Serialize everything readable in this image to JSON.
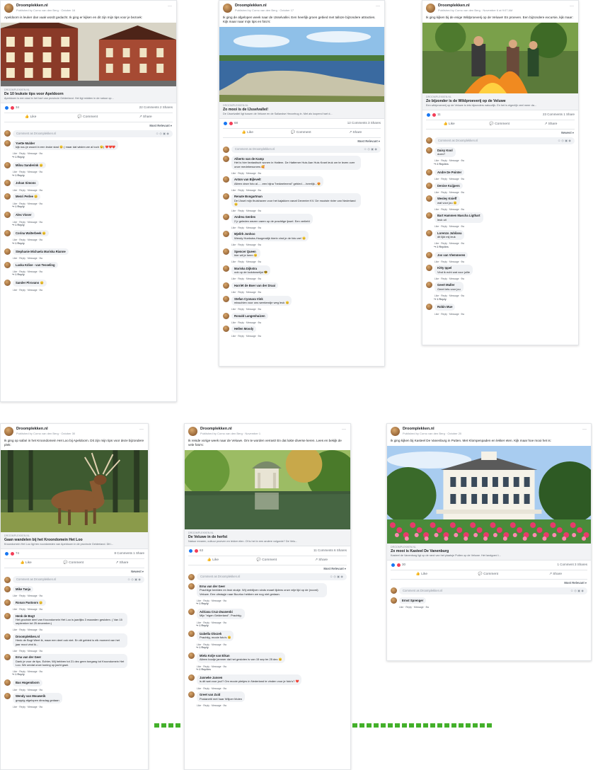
{
  "page_name": "Droomplekken.nl",
  "actions": {
    "like": "Like",
    "comment": "Comment",
    "share": "Share"
  },
  "comment_placeholder": "Comment as Droomplekken.nl",
  "comment_meta": "Like · Reply · Message · 8w",
  "posts": [
    {
      "meta": "Published by Corno van den Berg · October 16",
      "caption": "Apeldoorn is leuker dan vaak wordt gedacht. Ik ging er kijken en dit zijn mijn tips voor je bezoek:",
      "domain": "DROOMPLEKKEN.NL",
      "title": "De 10 leukste tips voor Apeldoorn",
      "desc": "Apeldoorn is een stad in het hart van provincie Gelderland. Het ligt midden in de natuur op...",
      "reactions": "34",
      "counts": "22 Comments 2 Shares",
      "sort": "Most Relevant ▾",
      "comments": [
        {
          "name": "Yvette Mulder",
          "text": "kijk nou je woont in een leuke stad 😊 ( maar dat wisten we al toch 😉) ❤️❤️❤️",
          "reply": "↪ 1 Reply"
        },
        {
          "name": "Milou Sanderink 😊",
          "text": "",
          "reply": "↪ 1 Reply"
        },
        {
          "name": "Johan Simons",
          "text": "",
          "reply": ""
        },
        {
          "name": "Menri Perlee 😊",
          "text": "",
          "reply": "↪ 1 Reply"
        },
        {
          "name": "Alex Visser",
          "text": "",
          "reply": "↪ 1 Reply"
        },
        {
          "name": "Corina Walterbeek 😊",
          "text": "",
          "reply": "↪ 1 Reply"
        },
        {
          "name": "Stephanie Michaela Mariska Rianne",
          "text": "",
          "reply": ""
        },
        {
          "name": "Laska Kdise - van Tesseling",
          "text": "",
          "reply": "↪ 1 Reply"
        },
        {
          "name": "Sander Pirovano 😊",
          "text": "",
          "reply": ""
        }
      ]
    },
    {
      "meta": "Published by Corno van den Berg · October 17",
      "caption": "Ik ging de afgelopen week naar de IJsselvallei. Een heerlijk groen gebied met talloze bijzondere attracties. Kijk maar naar mijn tips en foto's:",
      "domain": "DROOMPLEKKEN.NL",
      "title": "Zo mooi is de IJsselvallei!",
      "desc": "De IJsselvallei ligt tussen de Veluwe en de Sallandse Heuvelrug in. Met als loopend hart d...",
      "reactions": "68",
      "counts": "12 Comments 3 Shares",
      "sort": "Most Relevant ▾",
      "comments": [
        {
          "name": "Alberto van de Kamp",
          "text": "Het is hier fantastisch wonen in Hattem. De Hattemer Huis Aan Huis Krant leuk om te lezen over onze medebewoners 🥰",
          "reply": ""
        },
        {
          "name": "Anton van Bijlevelt",
          "text": "Alleen deze foto al......een bijna \"bedwelmend\" gebied.....heerlijk...😍",
          "reply": ""
        },
        {
          "name": "Renate Bongartman",
          "text": "De IJssel mijn thuishaven voor het kajakken vanaf Deventer KV. De mooiste rivier van Nederland 😊",
          "reply": ""
        },
        {
          "name": "Andrea Gerdes",
          "text": "2 jr geleden wezen varen op de prachtige ijssel. Een verliefd",
          "reply": ""
        },
        {
          "name": "Mjelith Jonhoo",
          "text": "Wendy Hoekstra-Hoogendijk hierin vind je de foto we! 😊",
          "reply": ""
        },
        {
          "name": "Spencer Queen",
          "text": "hier wil je heen 😊",
          "reply": ""
        },
        {
          "name": "Mariska Dijkstra",
          "text": "ook op de lockdownlijst 😎",
          "reply": ""
        },
        {
          "name": "Harriët de Boer van der Draai",
          "text": "",
          "reply": ""
        },
        {
          "name": "Stefan Cyonara Vink",
          "text": "misschien voor ons weekendje weg leuk 😊",
          "reply": ""
        },
        {
          "name": "Ronald Langenhuizen",
          "text": "",
          "reply": ""
        },
        {
          "name": "Hellen Moody",
          "text": "",
          "reply": ""
        }
      ]
    },
    {
      "meta": "Published by Corno van den Berg · November 6 at 9:07 AM",
      "caption": "Ik ging kijken bij de enige Wildproeverij op de Veluwe! En proeven. Een bijzondere excursie, kijk maar:",
      "domain": "DROOMPLEKKEN.NL",
      "title": "Zo bijzonder is de Wildproeverij op de Veluwe",
      "desc": "Een wildproeverij op de Veluwe is iets bijzonders natuurlijk. En het is eigenlijk veel meer da...",
      "reactions": "11",
      "counts": "23 Comments 1 Share",
      "sort": "Newest ▾",
      "comments": [
        {
          "name": "Daisy Kool",
          "text": "doen?",
          "reply": "↪ 2 Replies"
        },
        {
          "name": "Andre De Pointer",
          "text": "",
          "reply": ""
        },
        {
          "name": "Denise Kuijpers",
          "text": "",
          "reply": ""
        },
        {
          "name": "Wesley Knieff",
          "text": "wat voor jou 😊",
          "reply": ""
        },
        {
          "name": "Bart Hammen Mascha Ligthart",
          "text": "leuk uit",
          "reply": ""
        },
        {
          "name": "Lorenzo Jubilana",
          "text": "dit lijkt mij leuk",
          "reply": "↪ 2 Replies"
        },
        {
          "name": "Jos van Vlemmeren",
          "text": "",
          "reply": ""
        },
        {
          "name": "Kitty Ippel",
          "text": "Vind ik echt wat voor jullie",
          "reply": ""
        },
        {
          "name": "Geert Muller",
          "text": "Geert iets voor jou",
          "reply": "↪ 1 Reply"
        },
        {
          "name": "Robin Mue",
          "text": "",
          "reply": ""
        }
      ]
    },
    {
      "meta": "Published by Corno van den Berg · October 30",
      "caption": "Ik ging op safari in het Kroondomein Het Loo bij Apeldoorn. Dit zijn mijn tips voor deze bijzondere plek:",
      "domain": "DROOMPLEKKEN.NL",
      "title": "Gaan wandelen bij het Kroondomein Het Loo",
      "desc": "Kroondomein Het Loo ligt ten noordwesten van Apeldoorn in de provincie Gelderland. Dit i...",
      "reactions": "74",
      "counts": "8 Comments 1 Share",
      "sort": "Newest ▾",
      "comments": [
        {
          "name": "Mike Tanja",
          "text": "",
          "reply": ""
        },
        {
          "name": "Ronan Pastoors 😊",
          "text": "",
          "reply": ""
        },
        {
          "name": "Henk de Bogt",
          "text": "Het grootste deel van Kroondomein Het Loo is jaarlijks 3 maanden gesloten. ( Van 15 september tot 25 december.)",
          "reply": ""
        },
        {
          "name": "Droomplekken.nl",
          "text": "Henk de Bogt Weet ik, maar een deel ook niet. En dit gebied is elk moment van het jaar mooi vind ik...",
          "reply": ""
        },
        {
          "name": "Erna van der Geer",
          "text": "Dank je voor de tips. Echter, Wij hebben tot 21 dec geen toegang tot Kroondomein Het Loo. We omdat onze koning op jacht gaat.",
          "reply": "↪ 1 Reply"
        },
        {
          "name": "Bas Hogendoorn",
          "text": "",
          "reply": ""
        },
        {
          "name": "Wendy van Mouwerik",
          "text": "grappig afgelopen dinsdag gedaan",
          "reply": ""
        }
      ]
    },
    {
      "meta": "Published by Corno van den Berg · November 1",
      "caption": "Ik reisde vorige week naar de Veluwe. Om te worden verrast! En dat lukte diverse keren. Lees en bekijk de vele foto's:",
      "domain": "DROOMPLEKKEN.NL",
      "title": "De Veluwe in de herfst",
      "desc": "Natuur ervaren, cultuur proeven en lekker eten. Of is het in een andere volgorde? De Velu...",
      "reactions": "63",
      "counts": "11 Comments 6 Shares",
      "sort": "Most Relevant ▾",
      "comments": [
        {
          "name": "Erna van der Geer",
          "text": "Prachtige beelden en leuk stukje. Wij verblijven sinds maart tijdens onze vrije tijd op de (noord) Veluwe. Een uitstapje naar Buurloo hebben we nog niet gedaan.",
          "reply": "↪ 1 Reply"
        },
        {
          "name": "Adriana Cruz-Zwanenbi",
          "text": "Mijn \"eigen Gelderland\". Prachtig.",
          "reply": "↪ 1 Reply"
        },
        {
          "name": "Izabella Obszek",
          "text": "Prachtig, mooie foto's 😊",
          "reply": "↪ 1 Reply"
        },
        {
          "name": "Miela Kolje van Eikan",
          "text": "Alleen bootje jammer dat het gesloten is van 15 sep tm 25 dec 😊",
          "reply": "↪ 2 Replies"
        },
        {
          "name": "Janneke Jansen",
          "text": "is dit wat voor jou!? Om mooie plekjes in Nederland te vinden voor je foto's? ❤️",
          "reply": ""
        },
        {
          "name": "Greet van Zuid",
          "text": "Postanetti met haar Wiljoer Molen",
          "reply": ""
        }
      ]
    },
    {
      "meta": "Published by Corno van den Berg · October 20",
      "caption": "Ik ging kijken bij Kasteel De Vanenburg in Putten. Met Klompenpaden en lekker eten. Kijk maar hoe mooi het is:",
      "domain": "DROOMPLEKKEN.NL",
      "title": "Zo mooi is Kasteel De Vanenburg",
      "desc": "Kasteel de Vanenburg ligt op de rand van het plaatsje Putten op de Veluwe. Het landgoed i...",
      "reactions": "30",
      "counts": "1 Comment 3 Shares",
      "sort": "Most Relevant ▾",
      "comments": [
        {
          "name": "Ernst Sprenger",
          "text": "",
          "reply": ""
        }
      ]
    }
  ]
}
